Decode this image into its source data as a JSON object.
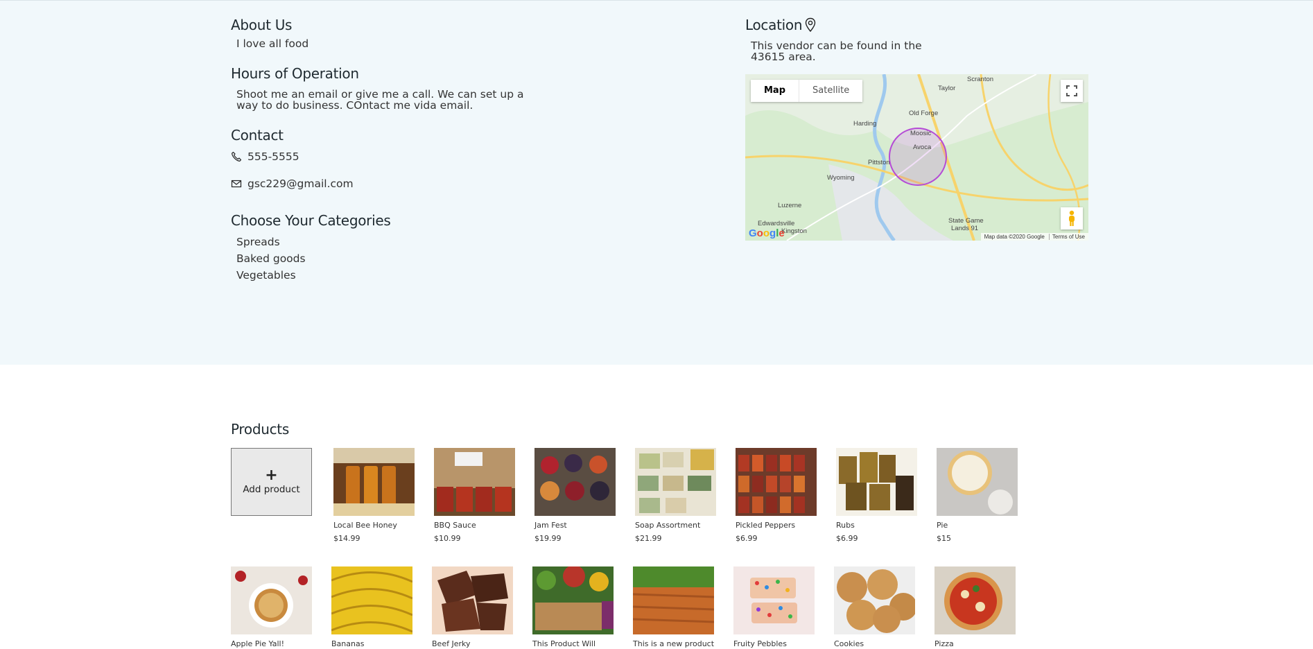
{
  "about": {
    "title": "About Us",
    "text": "I love all food"
  },
  "hours": {
    "title": "Hours of Operation",
    "text": "Shoot me an email or give me a call. We can set up a way to do business. COntact me vida email."
  },
  "contact": {
    "title": "Contact",
    "phone": "555-5555",
    "email": "gsc229@gmail.com",
    "phone_icon": "phone-icon",
    "email_icon": "envelope-icon"
  },
  "categories": {
    "title": "Choose Your Categories",
    "items": [
      "Spreads",
      "Baked goods",
      "Vegetables"
    ]
  },
  "location": {
    "title": "Location",
    "icon": "map-pin-icon",
    "text": "This vendor can be found in the 43615 area.",
    "map": {
      "type_map": "Map",
      "type_satellite": "Satellite",
      "attribution": "Map data ©2020 Google",
      "terms": "Terms of Use",
      "logo": "Google",
      "places": [
        "Scranton",
        "Taylor",
        "Old Forge",
        "Harding",
        "Moosic",
        "Avoca",
        "Pittston",
        "Wyoming",
        "Luzerne",
        "Edwardsville",
        "Kingston",
        "State Game",
        "Lands 91"
      ]
    }
  },
  "products": {
    "title": "Products",
    "add_label": "Add product",
    "add_symbol": "+",
    "row1": [
      {
        "name": "Local Bee Honey",
        "price": "$14.99"
      },
      {
        "name": "BBQ Sauce",
        "price": "$10.99"
      },
      {
        "name": "Jam Fest",
        "price": "$19.99"
      },
      {
        "name": "Soap Assortment",
        "price": "$21.99"
      },
      {
        "name": "Pickled Peppers",
        "price": "$6.99"
      },
      {
        "name": "Rubs",
        "price": "$6.99"
      },
      {
        "name": "Pie",
        "price": "$15"
      }
    ],
    "row2": [
      {
        "name": "Apple Pie Yall!"
      },
      {
        "name": "Bananas"
      },
      {
        "name": "Beef Jerky"
      },
      {
        "name": "This Product Will"
      },
      {
        "name": "This is a new product"
      },
      {
        "name": "Fruity Pebbles"
      },
      {
        "name": "Cookies"
      },
      {
        "name": "Pizza"
      }
    ]
  },
  "colors": {
    "band_bg": "#f1f8fb",
    "map_land": "#d7ecd0",
    "map_water": "#9fc9ee",
    "map_road": "#f7d36b",
    "radius_circle": "#b54bd6"
  }
}
